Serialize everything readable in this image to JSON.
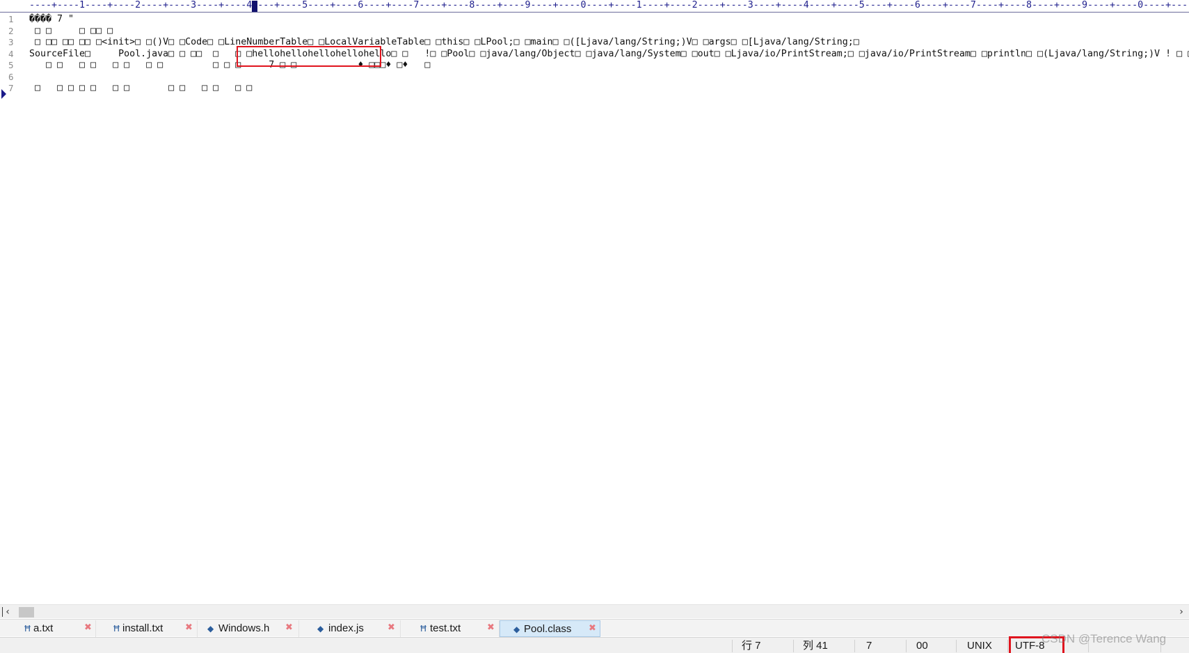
{
  "ruler": {
    "text": "----+----1----+----2----+----3----+----4----+----5----+----6----+----7----+----8----+----9----+----0----+----1----+----2----+----3----+----4----+----5----+----6----+----7----+----8----+----9----+----0----+---"
  },
  "editor": {
    "line_numbers": [
      "1",
      "2",
      "3",
      "4",
      "5",
      "6",
      "7"
    ],
    "current_line": "7",
    "lines": [
      "���� 7 \"",
      " □ □     □ □□ □",
      " □ □□ □□ □□ □<init>□ □()V□ □Code□ □LineNumberTable□ □LocalVariableTable□ □this□ □LPool;□ □main□ □([Ljava/lang/String;)V□ □args□ □[Ljava/lang/String;□",
      "SourceFile□     Pool.java□ □ □□  □   □ □hellohellohellohellohello□ □   !□ □Pool□ □java/lang/Object□ □java/lang/System□ □out□ □Ljava/io/PrintStream;□ □java/io/PrintStream□ □println□ □(Ljava/lang/String;)V ! □ □",
      "   □ □   □ □   □ □   □ □         □ □ □     7 □ □           ♦ □□□♦ □♦   □",
      "",
      " □   □ □ □ □   □ □       □ □   □ □   □ □"
    ]
  },
  "tabs": [
    {
      "label": "a.txt",
      "icon": "text-file-icon",
      "active": false
    },
    {
      "label": "install.txt",
      "icon": "text-file-icon",
      "active": false
    },
    {
      "label": "Windows.h",
      "icon": "source-file-icon",
      "active": false
    },
    {
      "label": "index.js",
      "icon": "source-file-icon",
      "active": false
    },
    {
      "label": "test.txt",
      "icon": "text-file-icon",
      "active": false
    },
    {
      "label": "Pool.class",
      "icon": "source-file-icon",
      "active": true
    }
  ],
  "status": {
    "row": "行 7",
    "col": "列 41",
    "sel": "7",
    "code": "00",
    "eol": "UNIX",
    "encoding": "UTF-8"
  },
  "watermark": "CSDN @Terence Wang",
  "colors": {
    "highlight_box": "#e0141e",
    "active_tab": "#d6e9f8",
    "ruler_text": "#1e1e8c"
  }
}
